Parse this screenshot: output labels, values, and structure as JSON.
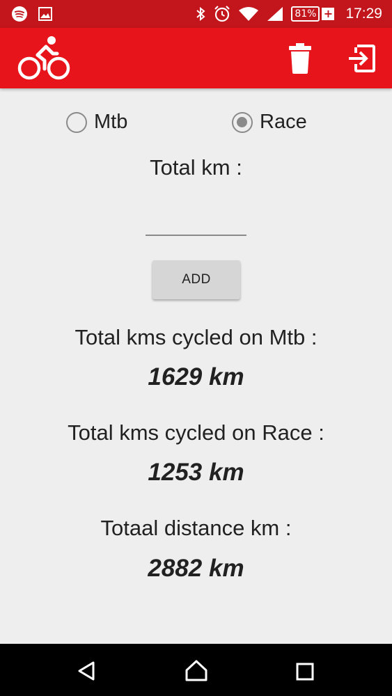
{
  "status_bar": {
    "battery_percent": "81%",
    "battery_charging_symbol": "+",
    "time": "17:29",
    "icons": [
      "spotify-icon",
      "image-icon",
      "bluetooth-icon",
      "alarm-icon",
      "wifi-icon",
      "signal-icon",
      "battery-icon"
    ]
  },
  "toolbar": {
    "icons": [
      "bicycle-icon",
      "trash-icon",
      "exit-icon"
    ],
    "background_color": "#E8141B"
  },
  "bike_type": {
    "options": [
      {
        "label": "Mtb",
        "selected": false
      },
      {
        "label": "Race",
        "selected": true
      }
    ]
  },
  "entry": {
    "label": "Total km :",
    "input_value": "",
    "input_placeholder": "",
    "add_label": "ADD"
  },
  "stats": {
    "mtb_label": "Total kms cycled on Mtb :",
    "mtb_value": "1629 km",
    "race_label": "Total kms cycled on Race :",
    "race_value": "1253 km",
    "total_label": "Totaal distance km :",
    "total_value": "2882 km"
  },
  "nav_bar": {
    "icons": [
      "back-icon",
      "home-icon",
      "recent-apps-icon"
    ]
  }
}
